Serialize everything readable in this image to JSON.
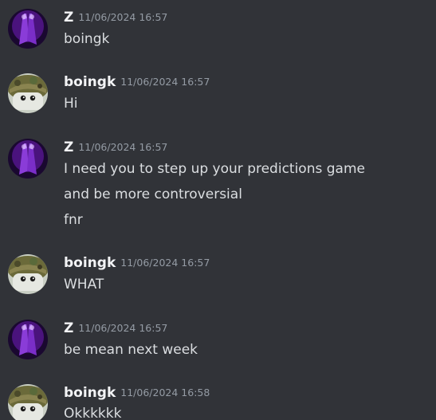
{
  "messages": [
    {
      "author": "Z",
      "avatar_icon": "purple-hands-avatar",
      "timestamp": "11/06/2024 16:57",
      "lines": [
        "boingk"
      ]
    },
    {
      "author": "boingk",
      "avatar_icon": "camo-bucket-hat-avatar",
      "timestamp": "11/06/2024 16:57",
      "lines": [
        "Hi"
      ]
    },
    {
      "author": "Z",
      "avatar_icon": "purple-hands-avatar",
      "timestamp": "11/06/2024 16:57",
      "lines": [
        "I need you to step up your predictions game",
        "and be more controversial",
        "fnr"
      ]
    },
    {
      "author": "boingk",
      "avatar_icon": "camo-bucket-hat-avatar",
      "timestamp": "11/06/2024 16:57",
      "lines": [
        "WHAT"
      ]
    },
    {
      "author": "Z",
      "avatar_icon": "purple-hands-avatar",
      "timestamp": "11/06/2024 16:57",
      "lines": [
        "be mean next week"
      ]
    },
    {
      "author": "boingk",
      "avatar_icon": "camo-bucket-hat-avatar",
      "timestamp": "11/06/2024 16:58",
      "lines": [
        "Okkkkkk"
      ]
    }
  ],
  "colors": {
    "background": "#313338",
    "username": "#f2f3f5",
    "timestamp": "#949ba4",
    "message_text": "#dbdee1"
  }
}
